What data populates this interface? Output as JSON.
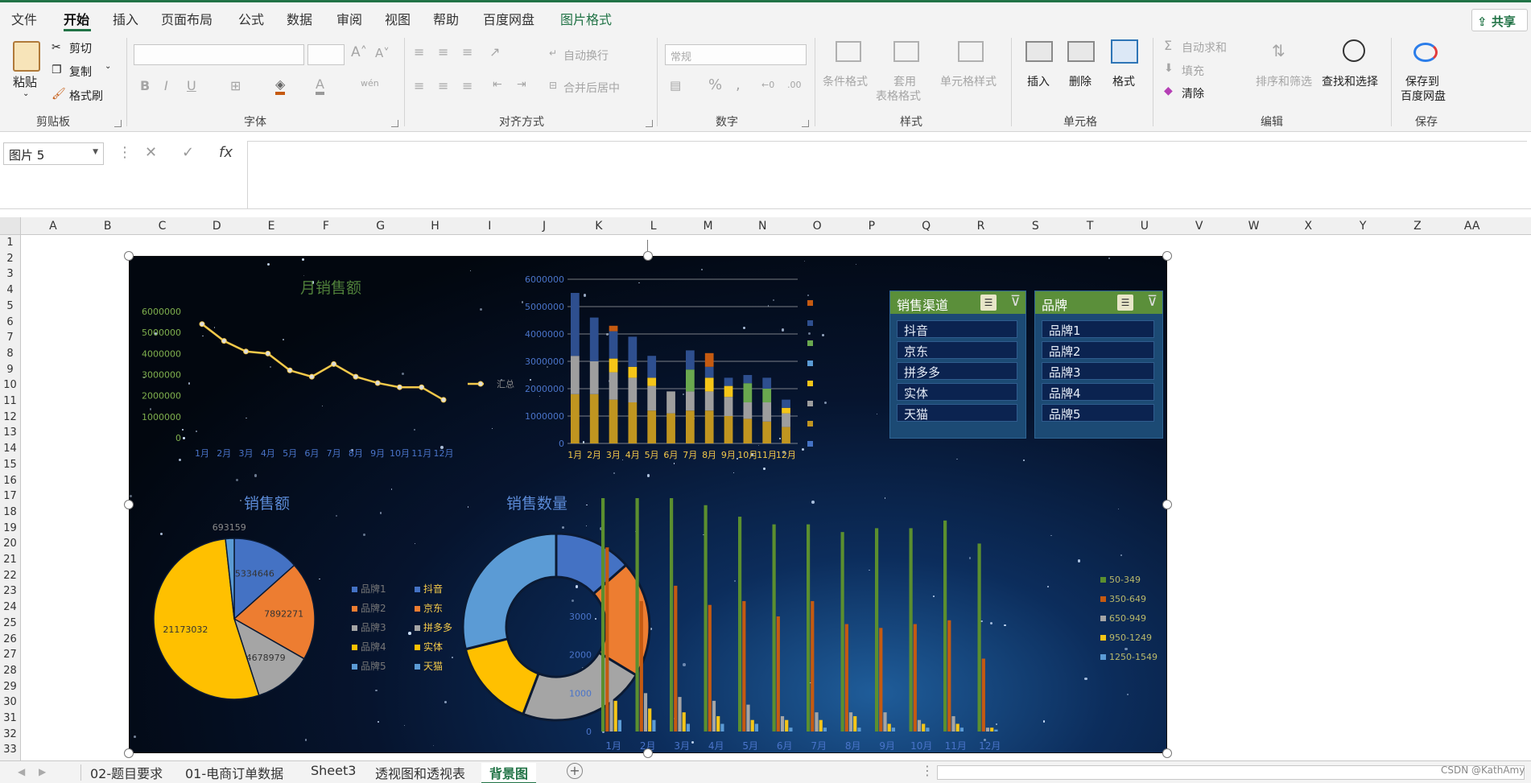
{
  "menu": {
    "tabs": [
      "文件",
      "开始",
      "插入",
      "页面布局",
      "公式",
      "数据",
      "审阅",
      "视图",
      "帮助",
      "百度网盘",
      "图片格式"
    ],
    "share": "共享"
  },
  "ribbon": {
    "clipboard": {
      "paste": "粘贴",
      "cut": "剪切",
      "copy": "复制",
      "format_painter": "格式刷",
      "group": "剪贴板"
    },
    "font": {
      "group": "字体"
    },
    "align": {
      "wrap": "自动换行",
      "merge": "合并后居中",
      "group": "对齐方式"
    },
    "number": {
      "format": "常规",
      "group": "数字"
    },
    "styles": {
      "cond": "条件格式",
      "table1": "套用",
      "table2": "表格格式",
      "cell": "单元格样式",
      "group": "样式"
    },
    "cells": {
      "insert": "插入",
      "delete": "删除",
      "format": "格式",
      "group": "单元格"
    },
    "edit": {
      "autosum": "自动求和",
      "fill": "填充",
      "clear": "清除",
      "sort": "排序和筛选",
      "find": "查找和选择",
      "group": "编辑"
    },
    "save": {
      "l1": "保存到",
      "l2": "百度网盘",
      "group": "保存"
    }
  },
  "formula": {
    "name_box": "图片 5",
    "fx": "fx"
  },
  "columns": [
    "A",
    "B",
    "C",
    "D",
    "E",
    "F",
    "G",
    "H",
    "I",
    "J",
    "K",
    "L",
    "M",
    "N",
    "O",
    "P",
    "Q",
    "R",
    "S",
    "T",
    "U",
    "V",
    "W",
    "X",
    "Y",
    "Z",
    "AA"
  ],
  "rows": [
    "1",
    "2",
    "3",
    "4",
    "5",
    "6",
    "7",
    "8",
    "9",
    "10",
    "11",
    "12",
    "13",
    "14",
    "15",
    "16",
    "17",
    "18",
    "19",
    "20",
    "21",
    "22",
    "23",
    "24",
    "25",
    "26",
    "27",
    "28",
    "29",
    "30",
    "31",
    "32",
    "33"
  ],
  "sheets": [
    "02-题目要求",
    "01-电商订单数据",
    "Sheet3",
    "透视图和透视表",
    "背景图"
  ],
  "watermark": "CSDN @KathAmy",
  "slicers": [
    {
      "title": "销售渠道",
      "items": [
        "抖音",
        "京东",
        "拼多多",
        "实体",
        "天猫"
      ]
    },
    {
      "title": "品牌",
      "items": [
        "品牌1",
        "品牌2",
        "品牌3",
        "品牌4",
        "品牌5"
      ]
    }
  ],
  "legends": {
    "brands": [
      "品牌1",
      "品牌2",
      "品牌3",
      "品牌4",
      "品牌5"
    ],
    "channels": [
      "抖音",
      "京东",
      "拼多多",
      "实体",
      "天猫"
    ],
    "price": [
      "50-349",
      "350-649",
      "650-949",
      "950-1249",
      "1250-1549"
    ]
  },
  "chart_data": [
    {
      "type": "line",
      "title": "月销售额",
      "categories": [
        "1月",
        "2月",
        "3月",
        "4月",
        "5月",
        "6月",
        "7月",
        "8月",
        "9月",
        "10月",
        "11月",
        "12月"
      ],
      "series": [
        {
          "name": "汇总",
          "values": [
            5400000,
            4600000,
            4100000,
            4000000,
            3200000,
            2900000,
            3500000,
            2900000,
            2600000,
            2400000,
            2400000,
            1800000
          ]
        }
      ],
      "ylim": [
        0,
        6000000
      ],
      "yticks": [
        "6000000",
        "5000000",
        "4000000",
        "3000000",
        "2000000",
        "1000000",
        "0"
      ],
      "color": "#f3c94a"
    },
    {
      "type": "bar",
      "stacked": true,
      "categories": [
        "1月",
        "2月",
        "3月",
        "4月",
        "5月",
        "6月",
        "7月",
        "8月",
        "9月",
        "10月",
        "11月",
        "12月"
      ],
      "ylim": [
        0,
        6000000
      ],
      "yticks": [
        "6000000",
        "5000000",
        "4000000",
        "3000000",
        "2000000",
        "1000000",
        "0"
      ],
      "series": [
        {
          "color": "#c09520",
          "values": [
            1800000,
            1800000,
            1600000,
            1500000,
            1200000,
            1100000,
            1200000,
            1200000,
            1000000,
            900000,
            800000,
            600000
          ]
        },
        {
          "color": "#9e9e9e",
          "values": [
            1400000,
            1200000,
            1000000,
            900000,
            900000,
            800000,
            700000,
            700000,
            700000,
            600000,
            700000,
            500000
          ]
        },
        {
          "color": "#f5c518",
          "values": [
            0,
            0,
            500000,
            400000,
            300000,
            0,
            0,
            500000,
            400000,
            0,
            0,
            200000
          ]
        },
        {
          "color": "#6aa84f",
          "values": [
            0,
            0,
            0,
            0,
            0,
            0,
            800000,
            0,
            0,
            700000,
            500000,
            0
          ]
        },
        {
          "color": "#2e4f8f",
          "values": [
            2300000,
            1600000,
            1000000,
            1100000,
            800000,
            0,
            700000,
            400000,
            300000,
            300000,
            400000,
            300000
          ]
        },
        {
          "color": "#c55a11",
          "values": [
            0,
            0,
            200000,
            0,
            0,
            0,
            0,
            500000,
            0,
            0,
            0,
            0
          ]
        }
      ]
    },
    {
      "type": "pie",
      "title": "销售额",
      "values": [
        5334646,
        7892271,
        4678979,
        21173032,
        693159
      ],
      "labels": [
        "5334646",
        "7892271",
        "4678979",
        "21173032",
        "693159"
      ],
      "colors": [
        "#4472c4",
        "#ed7d31",
        "#a5a5a5",
        "#ffc000",
        "#5b9bd5"
      ]
    },
    {
      "type": "pie",
      "donut": true,
      "title": "销售数量",
      "values": [
        14,
        21,
        23,
        16,
        30
      ],
      "colors": [
        "#4472c4",
        "#ed7d31",
        "#a5a5a5",
        "#ffc000",
        "#5b9bd5"
      ]
    },
    {
      "type": "bar",
      "categories": [
        "1月",
        "2月",
        "3月",
        "4月",
        "5月",
        "6月",
        "7月",
        "8月",
        "9月",
        "10月",
        "11月",
        "12月"
      ],
      "yticks": [
        "3000",
        "2000",
        "1000",
        "0"
      ],
      "ylim": [
        0,
        6000
      ],
      "series": [
        {
          "name": "50-349",
          "color": "#5b8f2f",
          "values": [
            6100,
            6200,
            6300,
            5900,
            5600,
            5400,
            5400,
            5200,
            5300,
            5300,
            5500,
            4900
          ]
        },
        {
          "name": "350-649",
          "color": "#c55a11",
          "values": [
            4800,
            3400,
            3800,
            3300,
            3400,
            3000,
            3400,
            2800,
            2700,
            2800,
            2900,
            1900
          ]
        },
        {
          "name": "650-949",
          "color": "#a5a5a5",
          "values": [
            1500,
            1000,
            900,
            800,
            700,
            400,
            500,
            500,
            500,
            300,
            400,
            100
          ]
        },
        {
          "name": "950-1249",
          "color": "#f5c518",
          "values": [
            800,
            600,
            500,
            400,
            300,
            300,
            300,
            400,
            200,
            200,
            200,
            100
          ]
        },
        {
          "name": "1250-1549",
          "color": "#5b9bd5",
          "values": [
            300,
            300,
            200,
            200,
            200,
            100,
            100,
            100,
            100,
            100,
            100,
            50
          ]
        }
      ]
    }
  ]
}
